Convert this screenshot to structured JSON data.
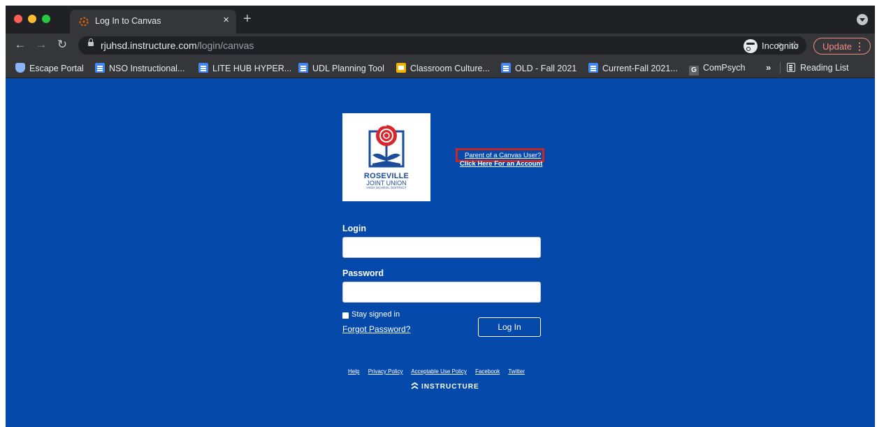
{
  "browser": {
    "tab_title": "Log In to Canvas",
    "tab_close": "×",
    "new_tab": "+",
    "url_host": "rjuhsd.instructure.com",
    "url_path": "/login/canvas",
    "incognito_label": "Incognito",
    "update_label": "Update",
    "update_menu": "⋮"
  },
  "bookmarks": {
    "items": [
      {
        "label": "Escape Portal",
        "icon": "shield-icon"
      },
      {
        "label": "NSO Instructional...",
        "icon": "doc-icon"
      },
      {
        "label": "LITE HUB HYPER...",
        "icon": "doc-icon"
      },
      {
        "label": "UDL Planning Tool",
        "icon": "doc-icon"
      },
      {
        "label": "Classroom Culture...",
        "icon": "slides-icon"
      },
      {
        "label": "OLD - Fall 2021",
        "icon": "doc-icon"
      },
      {
        "label": "Current-Fall 2021...",
        "icon": "doc-icon"
      },
      {
        "label": "ComPsych",
        "icon": "g-icon"
      }
    ],
    "overflow": "»",
    "reading_list": "Reading List"
  },
  "logo": {
    "title": "ROSEVILLE",
    "subtitle": "JOINT UNION",
    "subtitle2": "HIGH SCHOOL DISTRICT"
  },
  "parent_link": {
    "line1": "Parent of a Canvas User?",
    "line2": "Click Here For an Account"
  },
  "login_form": {
    "login_label": "Login",
    "password_label": "Password",
    "stay_signed_in": "Stay signed in",
    "forgot_password": "Forgot Password?",
    "login_button": "Log In"
  },
  "footer": {
    "links": [
      "Help",
      "Privacy Policy",
      "Acceptable Use Policy",
      "Facebook",
      "Twitter"
    ],
    "brand": "INSTRUCTURE"
  },
  "colors": {
    "page_background": "#0549ab",
    "highlight_border": "#c62828",
    "update_accent": "#f28b82"
  }
}
